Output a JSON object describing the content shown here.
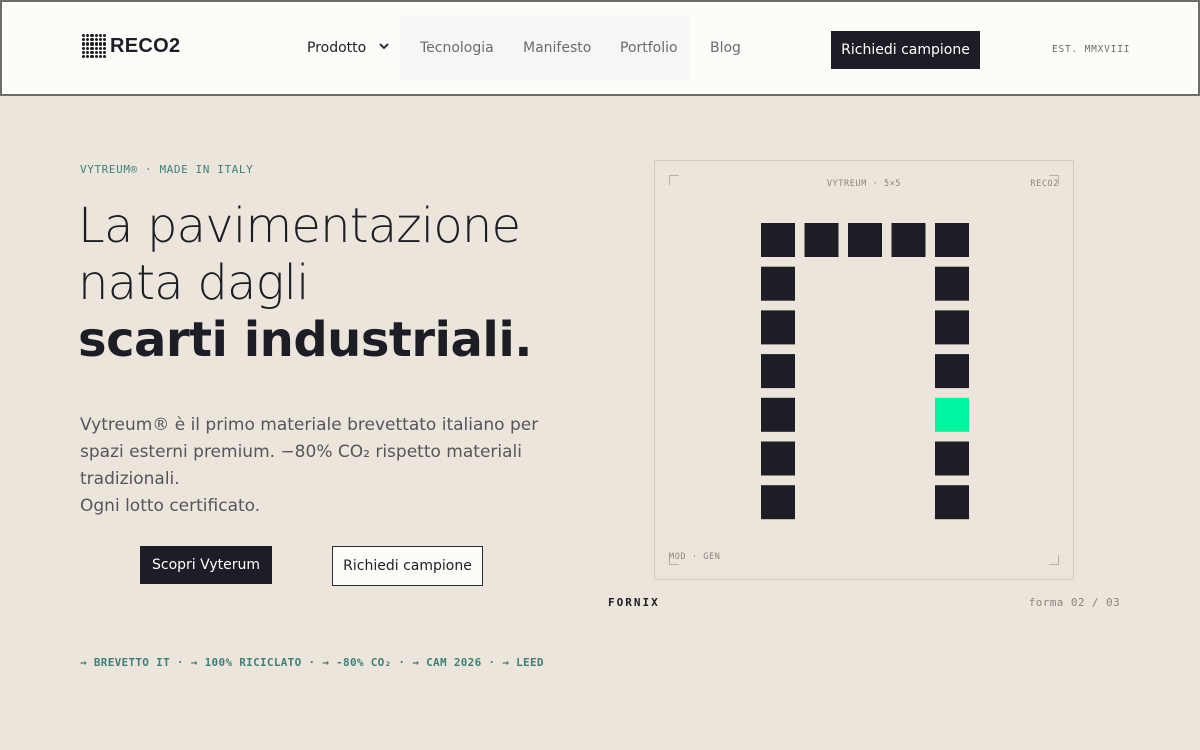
{
  "nav": {
    "logo_text": "RECO2",
    "items": [
      {
        "label": "Prodotto"
      },
      {
        "label": "Tecnologia"
      },
      {
        "label": "Manifesto"
      },
      {
        "label": "Portfolio"
      },
      {
        "label": "Blog"
      }
    ],
    "cta_label": "Richiedi campione",
    "est_label": "EST. MMXVIII"
  },
  "hero": {
    "eyebrow": "VYTREUM® · MADE IN ITALY",
    "headline_line1": "La pavimentazione",
    "headline_line2": "nata dagli",
    "headline_bold": "scarti industriali.",
    "description_line1": "Vytreum® è il primo materiale brevettato italiano per spazi esterni premium. −80% CO₂ rispetto materiali tradizionali.",
    "description_line2": "Ogni lotto certificato.",
    "primary_button": "Scopri Vyterum",
    "secondary_button": "Richiedi campione",
    "badges": "→ BREVETTO IT · → 100% RICICLATO · → -80% CO₂ · → CAM 2026 · → LEED"
  },
  "preview": {
    "title": "VYTREUM · 5×5",
    "brand": "RECO2",
    "mode": "MOD · GEN",
    "shape_name": "FORNIX",
    "counter": "forma 02 / 03",
    "colors": {
      "tile": "#1d1d26",
      "accent": "#00f5a0"
    },
    "pattern": [
      [
        1,
        1,
        1,
        1,
        1
      ],
      [
        1,
        0,
        0,
        0,
        1
      ],
      [
        1,
        0,
        0,
        0,
        1
      ],
      [
        1,
        0,
        0,
        0,
        1
      ],
      [
        1,
        0,
        0,
        0,
        2
      ],
      [
        1,
        0,
        0,
        0,
        1
      ],
      [
        1,
        0,
        0,
        0,
        1
      ]
    ]
  }
}
